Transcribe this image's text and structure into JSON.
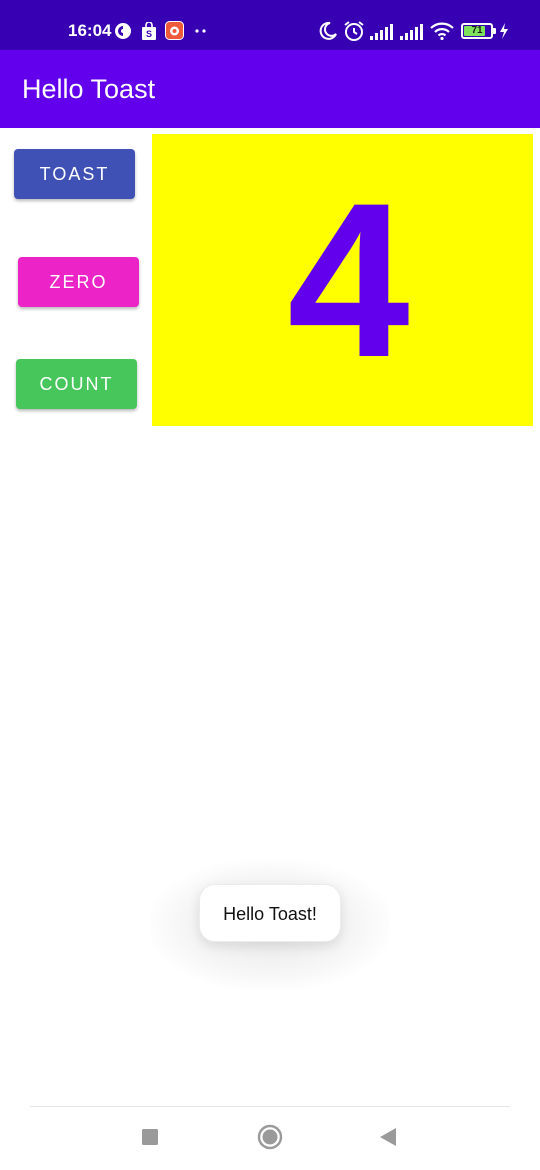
{
  "status_bar": {
    "time": "16:04",
    "battery": "71",
    "left_icons": [
      "app-icon-c",
      "shopping-bag-icon",
      "app-icon-red",
      "more-dots-icon"
    ],
    "right_icons": [
      "moon-icon",
      "alarm-icon",
      "signal-icon",
      "signal-icon-2",
      "wifi-icon",
      "battery-icon",
      "charging-icon"
    ],
    "background_color": "#3700b3"
  },
  "app_bar": {
    "title": "Hello Toast",
    "background_color": "#6200ee"
  },
  "buttons": {
    "toast": "TOAST",
    "zero": "ZERO",
    "count": "COUNT"
  },
  "counter": {
    "value": "4",
    "background_color": "#ffff00",
    "text_color": "#6200ee"
  },
  "toast_message": "Hello Toast!",
  "nav_bar": {
    "buttons": [
      "recents-button",
      "home-button",
      "back-button"
    ]
  }
}
